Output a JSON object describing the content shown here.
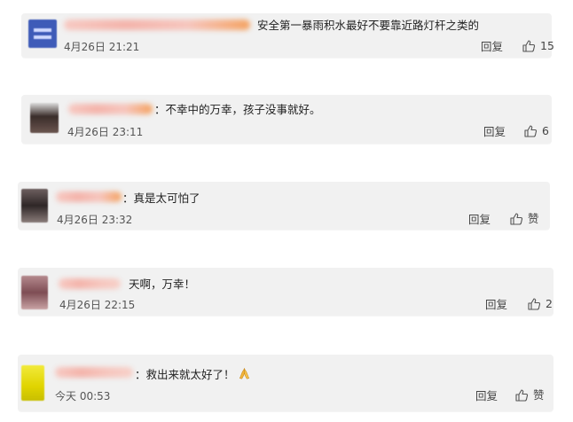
{
  "comments": [
    {
      "content": "安全第一暴雨积水最好不要靠近路灯杆之类的",
      "time": "4月26日 21:21",
      "reply": "回复",
      "likes": "15",
      "avatar_color": "#3e5bb8",
      "name_color": "#f6b3a6"
    },
    {
      "content": "：不幸中的万幸，孩子没事就好。",
      "time": "4月26日 23:11",
      "reply": "回复",
      "likes": "6",
      "avatar_color": "#4a3a36",
      "name_color": "#f6b3a6"
    },
    {
      "content": "：真是太可怕了",
      "time": "4月26日 23:32",
      "reply": "回复",
      "likes": "赞",
      "avatar_color": "#3b3232",
      "name_color": "#f6b3a6"
    },
    {
      "content": "天啊，万幸！",
      "time": "4月26日 22:15",
      "reply": "回复",
      "likes": "2",
      "avatar_color": "#8a5a60",
      "name_color": "#f6b3a6"
    },
    {
      "content": "：救出来就太好了！",
      "time": "今天 00:53",
      "reply": "回复",
      "likes": "赞",
      "avatar_color": "#e2d800",
      "name_color": "#f6b3a6"
    }
  ]
}
